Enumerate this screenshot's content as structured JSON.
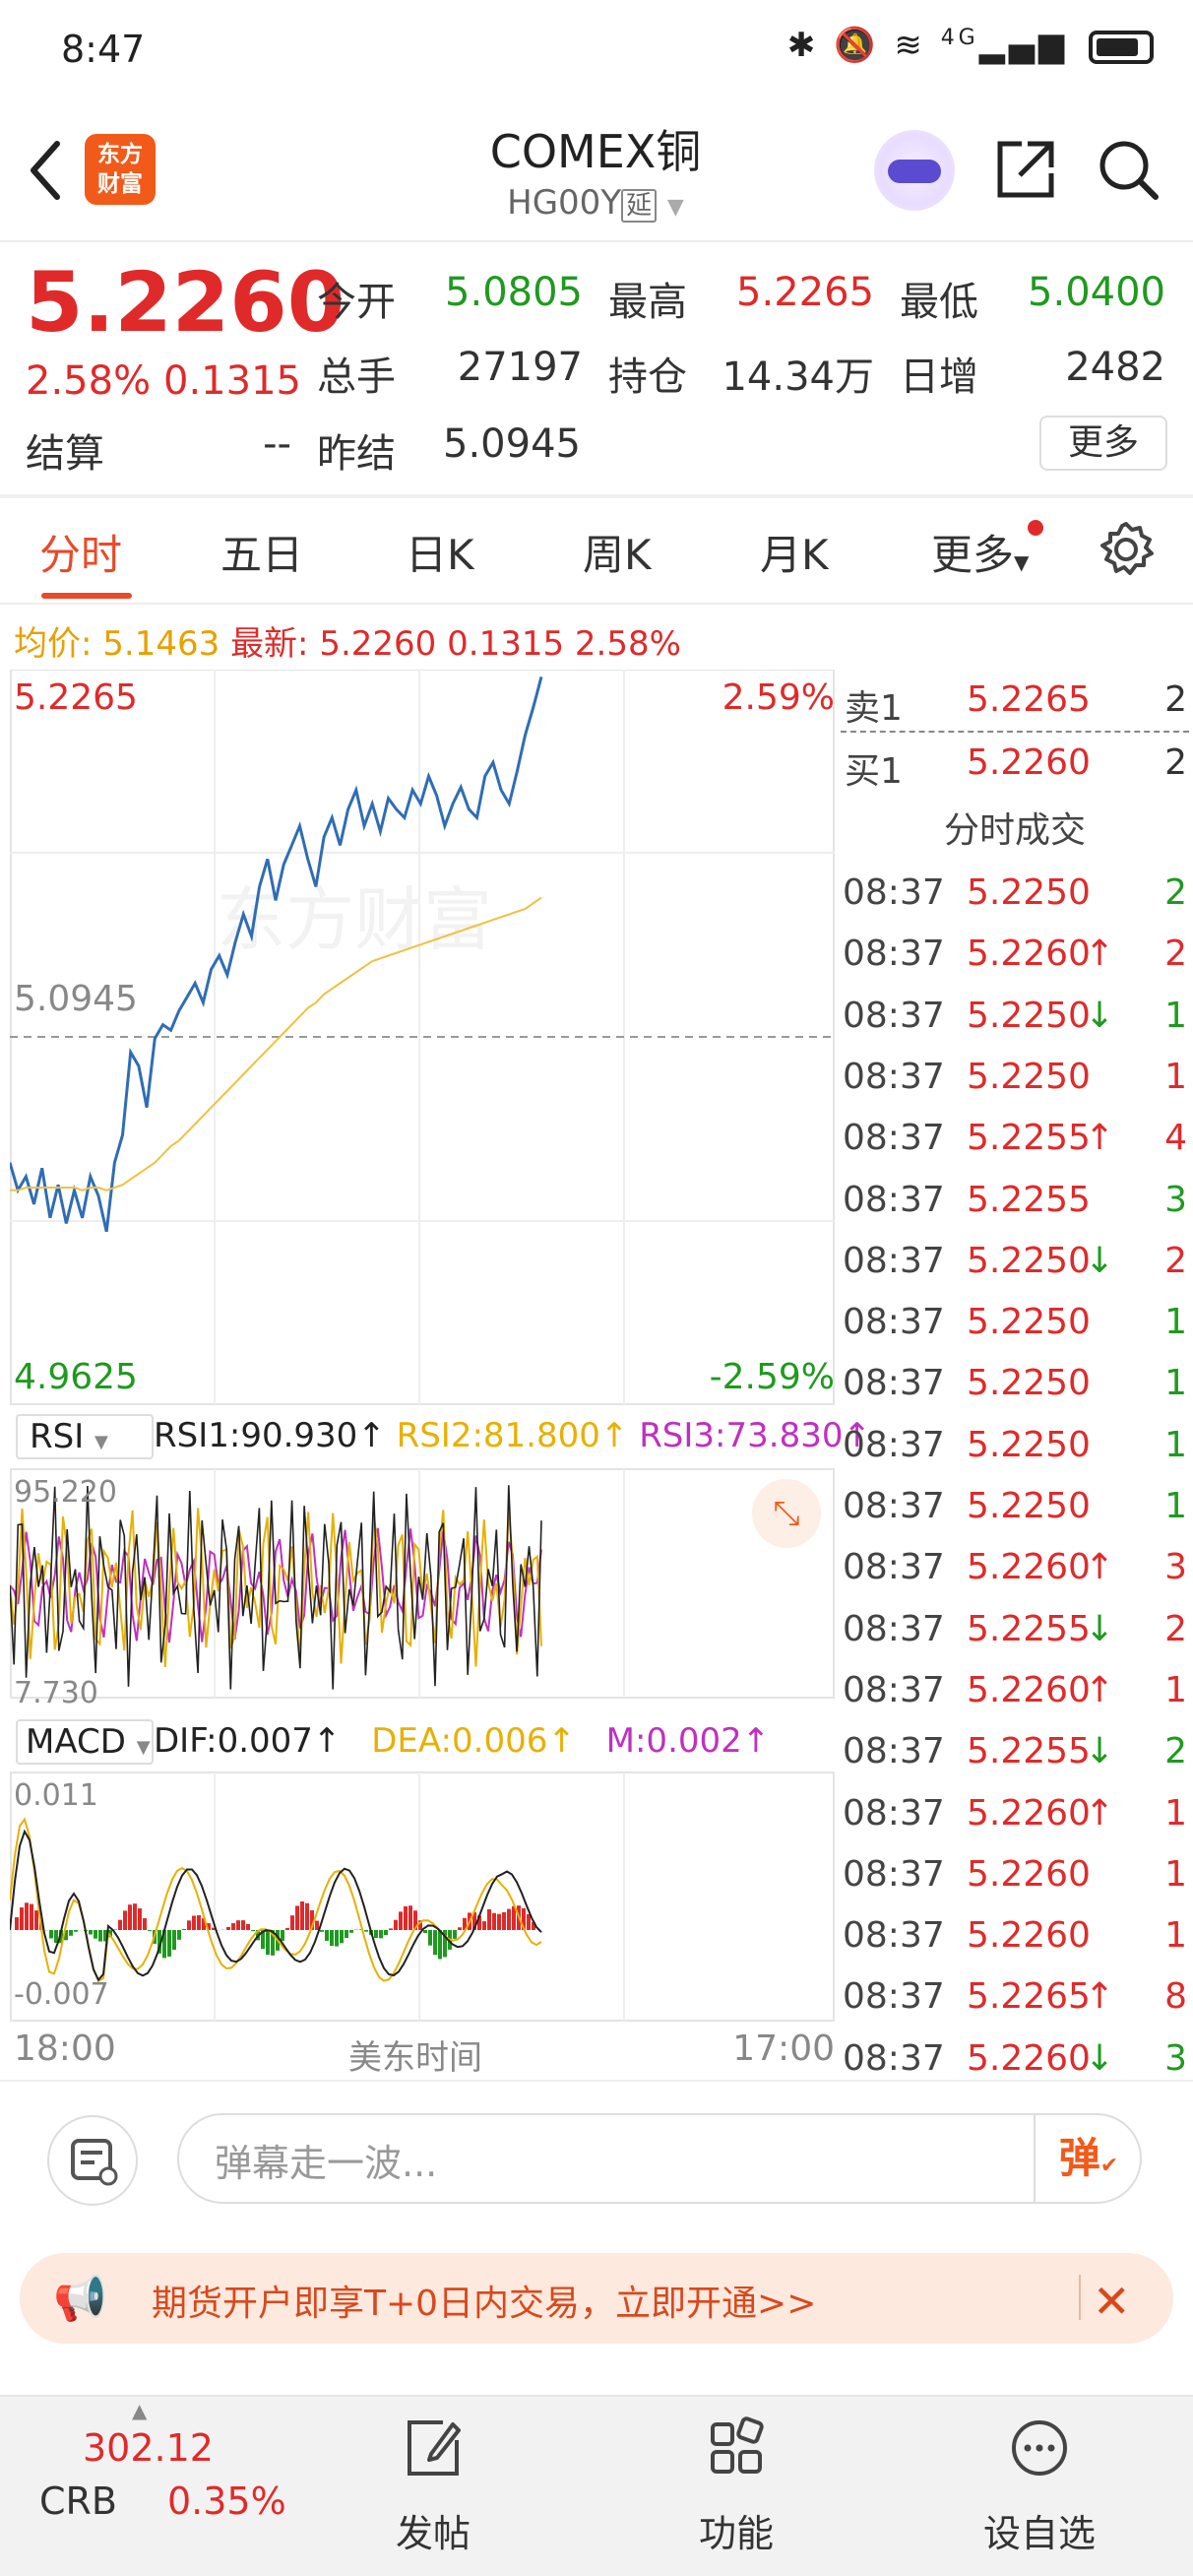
{
  "status_bar": {
    "time": "8:47",
    "network": "4G"
  },
  "header": {
    "title": "COMEX铜",
    "subtitle_code": "HG00Y",
    "subtitle_tag": "延",
    "logo_text_1": "东方",
    "logo_text_2": "财富"
  },
  "quote": {
    "last_price": "5.2260",
    "change_pct": "2.58%",
    "change_amt": "0.1315",
    "labels": {
      "open": "今开",
      "high": "最高",
      "low": "最低",
      "volume": "总手",
      "position": "持仓",
      "daily_inc": "日增",
      "settle": "结算",
      "prev_settle": "昨结"
    },
    "open": "5.0805",
    "high": "5.2265",
    "low": "5.0400",
    "volume": "27197",
    "position": "14.34万",
    "daily_inc": "2482",
    "settle": "--",
    "prev_settle": "5.0945",
    "more_button": "更多"
  },
  "tabs": [
    "分时",
    "五日",
    "日K",
    "周K",
    "月K",
    "更多"
  ],
  "indicator_line": {
    "avg_label": "均价:",
    "avg_value": "5.1463",
    "latest_label": "最新:",
    "latest_value": "5.2260",
    "change_amt": "0.1315",
    "change_pct": "2.58%"
  },
  "chart_data": {
    "type": "line",
    "price_axis": {
      "top": "5.2265",
      "mid": "5.0945",
      "bottom": "4.9625",
      "top_pct": "2.59%",
      "bottom_pct": "-2.59%"
    },
    "watermark": "东方财富",
    "series": [
      {
        "name": "price",
        "color": "#2f6db5",
        "values": [
          5.05,
          5.04,
          5.045,
          5.035,
          5.048,
          5.03,
          5.042,
          5.028,
          5.04,
          5.03,
          5.045,
          5.038,
          5.025,
          5.05,
          5.06,
          5.09,
          5.085,
          5.07,
          5.095,
          5.1,
          5.098,
          5.105,
          5.11,
          5.115,
          5.108,
          5.12,
          5.125,
          5.118,
          5.13,
          5.14,
          5.132,
          5.15,
          5.16,
          5.145,
          5.158,
          5.165,
          5.172,
          5.16,
          5.15,
          5.168,
          5.175,
          5.165,
          5.178,
          5.185,
          5.172,
          5.18,
          5.17,
          5.182,
          5.178,
          5.175,
          5.185,
          5.18,
          5.19,
          5.183,
          5.172,
          5.18,
          5.186,
          5.178,
          5.175,
          5.19,
          5.195,
          5.185,
          5.18,
          5.192,
          5.205,
          5.215,
          5.226
        ]
      },
      {
        "name": "avg",
        "color": "#f0c040",
        "values": [
          5.04,
          5.04,
          5.041,
          5.041,
          5.041,
          5.041,
          5.041,
          5.041,
          5.041,
          5.04,
          5.041,
          5.041,
          5.04,
          5.041,
          5.042,
          5.044,
          5.046,
          5.048,
          5.05,
          5.053,
          5.056,
          5.058,
          5.061,
          5.064,
          5.067,
          5.07,
          5.073,
          5.076,
          5.079,
          5.082,
          5.085,
          5.088,
          5.091,
          5.094,
          5.097,
          5.1,
          5.103,
          5.106,
          5.108,
          5.111,
          5.113,
          5.115,
          5.117,
          5.119,
          5.121,
          5.123,
          5.124,
          5.125,
          5.126,
          5.127,
          5.128,
          5.129,
          5.13,
          5.131,
          5.132,
          5.133,
          5.134,
          5.135,
          5.136,
          5.137,
          5.138,
          5.139,
          5.14,
          5.141,
          5.142,
          5.144,
          5.146
        ]
      }
    ],
    "ylim": [
      4.9625,
      5.2265
    ],
    "rsi": {
      "selector": "RSI",
      "rsi1": "RSI1:90.930↑",
      "rsi2": "RSI2:81.800↑",
      "rsi3": "RSI3:73.830↑",
      "axis_top": "95.220",
      "axis_bottom": "7.730",
      "colors": {
        "rsi1": "#222222",
        "rsi2": "#e8b000",
        "rsi3": "#c030c0"
      }
    },
    "macd": {
      "selector": "MACD",
      "dif": "DIF:0.007↑",
      "dea": "DEA:0.006↑",
      "m": "M:0.002↑",
      "axis_top": "0.011",
      "axis_bottom": "-0.007"
    },
    "x_axis": {
      "left": "18:00",
      "center": "美东时间",
      "right": "17:00"
    }
  },
  "order_book": {
    "asks": [
      {
        "label": "卖1",
        "price": "5.2265",
        "qty": "2"
      }
    ],
    "bids": [
      {
        "label": "买1",
        "price": "5.2260",
        "qty": "2"
      }
    ],
    "trades_title": "分时成交",
    "trades": [
      {
        "time": "08:37",
        "price": "5.2250",
        "arrow": "",
        "qty": "2",
        "side": "sell"
      },
      {
        "time": "08:37",
        "price": "5.2260",
        "arrow": "↑",
        "qty": "2",
        "side": "buy"
      },
      {
        "time": "08:37",
        "price": "5.2250",
        "arrow": "↓",
        "qty": "1",
        "side": "sell"
      },
      {
        "time": "08:37",
        "price": "5.2250",
        "arrow": "",
        "qty": "1",
        "side": "buy"
      },
      {
        "time": "08:37",
        "price": "5.2255",
        "arrow": "↑",
        "qty": "4",
        "side": "buy"
      },
      {
        "time": "08:37",
        "price": "5.2255",
        "arrow": "",
        "qty": "3",
        "side": "sell"
      },
      {
        "time": "08:37",
        "price": "5.2250",
        "arrow": "↓",
        "qty": "2",
        "side": "buy"
      },
      {
        "time": "08:37",
        "price": "5.2250",
        "arrow": "",
        "qty": "1",
        "side": "sell"
      },
      {
        "time": "08:37",
        "price": "5.2250",
        "arrow": "",
        "qty": "1",
        "side": "sell"
      },
      {
        "time": "08:37",
        "price": "5.2250",
        "arrow": "",
        "qty": "1",
        "side": "sell"
      },
      {
        "time": "08:37",
        "price": "5.2250",
        "arrow": "",
        "qty": "1",
        "side": "sell"
      },
      {
        "time": "08:37",
        "price": "5.2260",
        "arrow": "↑",
        "qty": "3",
        "side": "buy"
      },
      {
        "time": "08:37",
        "price": "5.2255",
        "arrow": "↓",
        "qty": "2",
        "side": "buy"
      },
      {
        "time": "08:37",
        "price": "5.2260",
        "arrow": "↑",
        "qty": "1",
        "side": "buy"
      },
      {
        "time": "08:37",
        "price": "5.2255",
        "arrow": "↓",
        "qty": "2",
        "side": "sell"
      },
      {
        "time": "08:37",
        "price": "5.2260",
        "arrow": "↑",
        "qty": "1",
        "side": "buy"
      },
      {
        "time": "08:37",
        "price": "5.2260",
        "arrow": "",
        "qty": "1",
        "side": "buy"
      },
      {
        "time": "08:37",
        "price": "5.2260",
        "arrow": "",
        "qty": "1",
        "side": "buy"
      },
      {
        "time": "08:37",
        "price": "5.2265",
        "arrow": "↑",
        "qty": "8",
        "side": "buy"
      },
      {
        "time": "08:37",
        "price": "5.2260",
        "arrow": "↓",
        "qty": "3",
        "side": "sell"
      }
    ]
  },
  "comment_bar": {
    "placeholder": "弹幕走一波...",
    "send_label": "弹"
  },
  "promo": {
    "text": "期货开户即享T+0日内交易，立即开通>>"
  },
  "tabbar": {
    "crb_value": "302.12",
    "crb_label": "CRB",
    "crb_pct": "0.35%",
    "items": [
      {
        "label": "发帖",
        "icon": "edit-icon"
      },
      {
        "label": "功能",
        "icon": "grid-icon"
      },
      {
        "label": "设自选",
        "icon": "more-dots-icon"
      }
    ]
  },
  "colors": {
    "up": "#e02a2a",
    "down": "#1f9a1f",
    "accent": "#f25a1a"
  }
}
